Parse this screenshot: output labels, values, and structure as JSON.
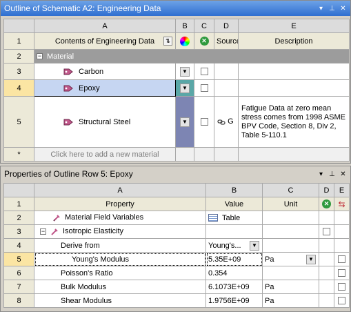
{
  "outline": {
    "title": "Outline of Schematic A2: Engineering Data",
    "columns": [
      "A",
      "B",
      "C",
      "D",
      "E"
    ],
    "header": {
      "row": "1",
      "contents": "Contents of Engineering Data",
      "source": "Source",
      "description": "Description"
    },
    "rows": [
      {
        "num": "2",
        "label": "Material"
      },
      {
        "num": "3",
        "label": "Carbon"
      },
      {
        "num": "4",
        "label": "Epoxy"
      },
      {
        "num": "5",
        "label": "Structural Steel",
        "source": "G",
        "description": [
          "Fatigue Data at zero mean",
          "stress comes from 1998 ASME",
          "BPV Code, Section 8, Div 2,",
          "Table 5-110.1"
        ]
      }
    ],
    "add_row": {
      "num": "*",
      "placeholder": "Click here to add a new material"
    }
  },
  "properties": {
    "title": "Properties of Outline Row 5: Epoxy",
    "columns": [
      "A",
      "B",
      "C",
      "D",
      "E"
    ],
    "header": {
      "row": "1",
      "property": "Property",
      "value": "Value",
      "unit": "Unit"
    },
    "rows": [
      {
        "num": "2",
        "property": "Material Field Variables",
        "value": "Table",
        "unit": ""
      },
      {
        "num": "3",
        "property": "Isotropic Elasticity",
        "value": "",
        "unit": ""
      },
      {
        "num": "4",
        "property": "Derive from",
        "value": "Young's...",
        "unit": ""
      },
      {
        "num": "5",
        "property": "Young's Modulus",
        "value": "5.35E+09",
        "unit": "Pa"
      },
      {
        "num": "6",
        "property": "Poisson's Ratio",
        "value": "0.354",
        "unit": ""
      },
      {
        "num": "7",
        "property": "Bulk Modulus",
        "value": "6.1073E+09",
        "unit": "Pa"
      },
      {
        "num": "8",
        "property": "Shear Modulus",
        "value": "1.9756E+09",
        "unit": "Pa"
      }
    ]
  },
  "titlebar_buttons": {
    "dropdown": "▾",
    "pin": "⊥",
    "close": "✕"
  },
  "colors": {
    "title_bar": "#2f6fd1",
    "selected_row": "#fbe5a3",
    "highlight": "#c6d6f2",
    "section": "#9c9c9c"
  }
}
